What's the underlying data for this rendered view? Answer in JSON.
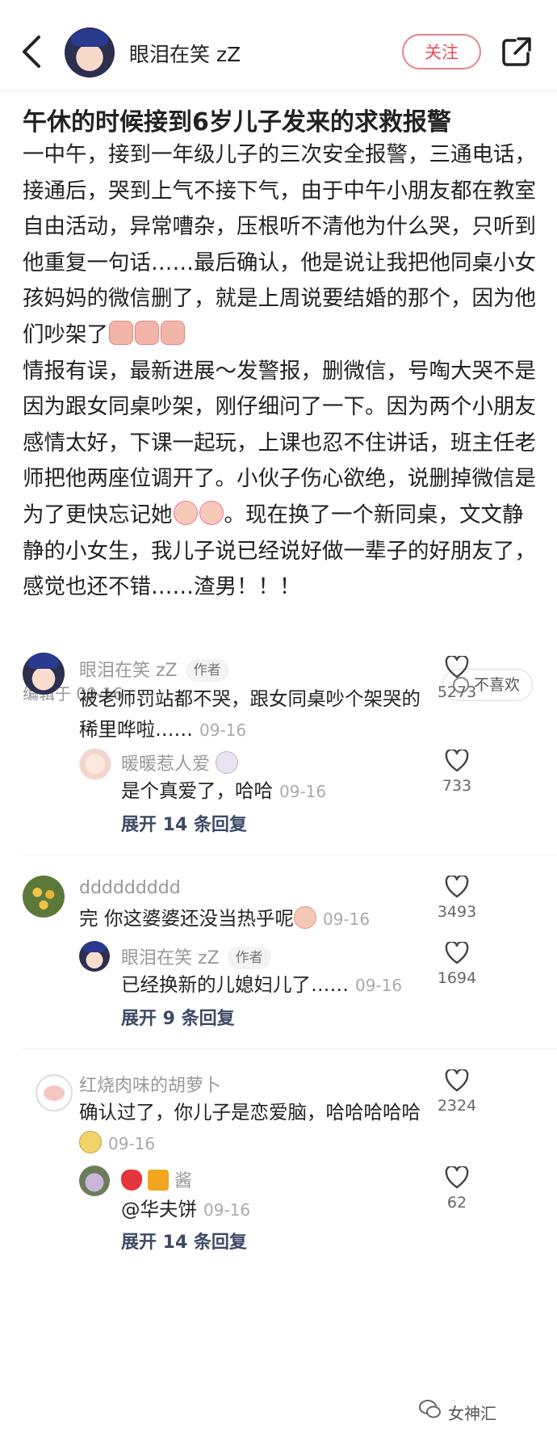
{
  "header": {
    "username": "眼泪在笑 zZ",
    "follow_label": "关注"
  },
  "post": {
    "title": "午休的时候接到6岁儿子发来的求救报警",
    "para1": "一中午，接到一年级儿子的三次安全报警，三通电话，接通后，哭到上气不接下气，由于中午小朋友都在教室自由活动，异常嘈杂，压根听不清他为什么哭，只听到他重复一句话……最后确认，他是说让我把他同桌小女孩妈妈的微信删了，就是上周说要结婚的那个，因为他们吵架了",
    "para2a": "情报有误，最新进展～发警报，删微信，号啕大哭不是因为跟女同桌吵架，刚仔细问了一下。因为两个小朋友感情太好，下课一起玩，上课也忍不住讲话，班主任老师把他两座位调开了。小伙子伤心欲绝，说删掉微信是为了更快忘记她",
    "para2b": "。现在换了一个新同桌，文文静静的小女生，我儿子说已经说好做一辈子的好朋友了，感觉也还不错……渣男！！！",
    "edited": "编辑于 09-16",
    "dislike_label": "不喜欢"
  },
  "comments": [
    {
      "name": "眼泪在笑 zZ",
      "tag": "作者",
      "text": "被老师罚站都不哭，跟女同桌吵个架哭的稀里哗啦……",
      "time": "09-16",
      "likes": "5273",
      "reply": {
        "name": "暖暖惹人爱",
        "text": "是个真爱了，哈哈",
        "time": "09-16",
        "likes": "733"
      },
      "expand": "展开 14 条回复"
    },
    {
      "name": "ddddddddd",
      "text": "完 你这婆婆还没当热乎呢",
      "time": "09-16",
      "likes": "3493",
      "reply": {
        "name": "眼泪在笑 zZ",
        "tag": "作者",
        "text": "已经换新的儿媳妇儿了……",
        "time": "09-16",
        "likes": "1694"
      },
      "expand": "展开 9 条回复"
    },
    {
      "name": "红烧肉味的胡萝卜",
      "text": "确认过了，你儿子是恋爱脑，哈哈哈哈哈",
      "time": "09-16",
      "likes": "2324",
      "reply": {
        "name": "酱",
        "text": "@华夫饼",
        "time": "09-16",
        "likes": "62"
      },
      "expand": "展开 14 条回复"
    }
  ],
  "watermark": "女神汇"
}
